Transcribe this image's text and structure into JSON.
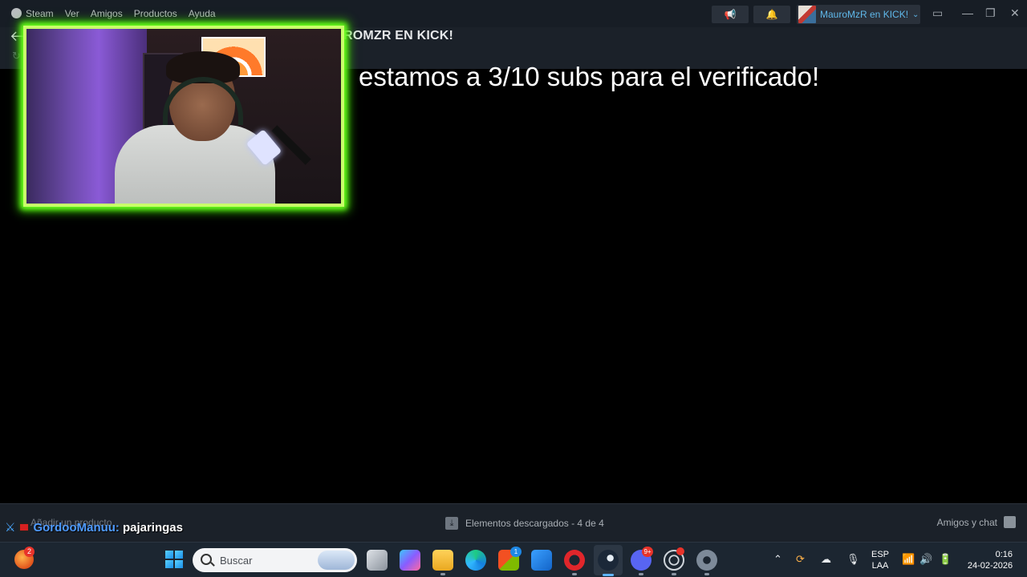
{
  "steam": {
    "menu": [
      "Steam",
      "Ver",
      "Amigos",
      "Productos",
      "Ayuda"
    ],
    "user_name": "MauroMzR en KICK!",
    "page_header": "ROMZR EN KICK!",
    "add_product": "Añadir un producto",
    "downloads": "Elementos descargados - 4 de 4",
    "friends_chat": "Amigos y chat"
  },
  "overlay": {
    "text": "estamos a 3/10 subs para el verificado!"
  },
  "chat": {
    "user": "GordooManuu:",
    "message": "pajaringas"
  },
  "taskbar": {
    "search_label": "Buscar",
    "widget_badge": "2",
    "discord_badge": "9+",
    "store_badge": "1",
    "language": "ESP",
    "layout": "LAA",
    "time": "0:16",
    "date": "24-02-2026"
  },
  "icons": {
    "back": "back-arrow-icon",
    "refresh": "refresh-icon",
    "megaphone": "megaphone-icon",
    "bell": "bell-icon",
    "monitor": "monitor-icon",
    "minimize": "minimize-icon",
    "restore": "restore-icon",
    "close": "close-icon"
  },
  "colors": {
    "steam_bg": "#171d25",
    "neon_frame": "#6cff20",
    "user_link": "#5fb8ea",
    "chat_user": "#4f9bff"
  }
}
